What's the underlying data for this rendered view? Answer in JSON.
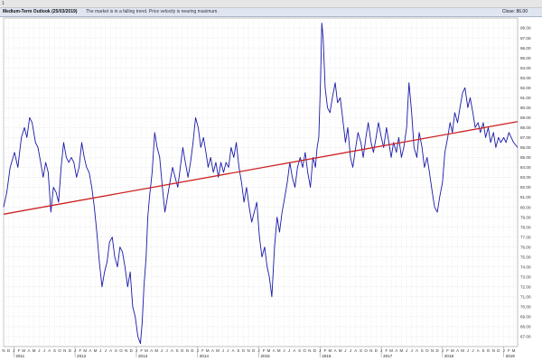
{
  "window": {
    "tag": "1",
    "title": "Medium-Term Outlook (25/03/2019)",
    "description": "The market is in a falling trend. Price velocity is nearing maximum.",
    "close_label": "Close:",
    "close_value": "86.00"
  },
  "chart_data": {
    "type": "line",
    "title": "Medium-Term Outlook (25/03/2019)",
    "x_axis": {
      "range": [
        "2010-11-01",
        "2019-03-25"
      ],
      "year_labels": [
        "2011",
        "2012",
        "2013",
        "2014",
        "2015",
        "2016",
        "2017",
        "2018",
        "2019"
      ],
      "month_labels": [
        "N",
        "D",
        "J",
        "F",
        "M",
        "A",
        "M",
        "J",
        "J",
        "A",
        "S",
        "O",
        "N",
        "D",
        "J",
        "F",
        "M",
        "A",
        "M",
        "J",
        "J",
        "A",
        "S",
        "O",
        "N",
        "D",
        "J",
        "F",
        "M",
        "A",
        "M",
        "J",
        "J",
        "A",
        "S",
        "O",
        "N",
        "D",
        "J",
        "F",
        "M",
        "A",
        "M",
        "J",
        "J",
        "A",
        "S",
        "O",
        "N",
        "D",
        "J",
        "F",
        "M",
        "A",
        "M",
        "J",
        "J",
        "A",
        "S",
        "O",
        "N",
        "D",
        "J",
        "F",
        "M",
        "A",
        "M",
        "J",
        "J",
        "A",
        "S",
        "O",
        "N",
        "D",
        "J",
        "F",
        "M",
        "A",
        "M",
        "J",
        "J",
        "A",
        "S",
        "O",
        "N",
        "D",
        "J",
        "F",
        "M",
        "A",
        "M",
        "J",
        "J",
        "A",
        "S",
        "O",
        "N",
        "D",
        "J",
        "F",
        "M"
      ]
    },
    "y_axis": {
      "position": "right",
      "range": [
        66,
        99
      ],
      "tick_labels": [
        "67.00",
        "68.00",
        "69.00",
        "70.00",
        "71.00",
        "72.00",
        "73.00",
        "74.00",
        "75.00",
        "76.00",
        "77.00",
        "78.00",
        "79.00",
        "80.00",
        "81.00",
        "82.00",
        "83.00",
        "84.00",
        "85.00",
        "86.00",
        "87.00",
        "88.00",
        "89.00",
        "90.00",
        "91.00",
        "92.00",
        "93.00",
        "94.00",
        "95.00",
        "96.00",
        "97.00",
        "98.00"
      ]
    },
    "grid": true,
    "series": [
      {
        "kind": "price",
        "color": "#1a1aaa",
        "points": [
          [
            "2010-11-01",
            80.0
          ],
          [
            "2010-11-20",
            81.5
          ],
          [
            "2010-12-10",
            84.0
          ],
          [
            "2011-01-05",
            85.5
          ],
          [
            "2011-01-25",
            84.0
          ],
          [
            "2011-02-15",
            87.0
          ],
          [
            "2011-03-05",
            88.0
          ],
          [
            "2011-03-20",
            87.0
          ],
          [
            "2011-04-05",
            89.0
          ],
          [
            "2011-04-20",
            88.5
          ],
          [
            "2011-05-10",
            86.5
          ],
          [
            "2011-05-25",
            86.0
          ],
          [
            "2011-06-10",
            84.5
          ],
          [
            "2011-06-25",
            83.0
          ],
          [
            "2011-07-10",
            84.5
          ],
          [
            "2011-07-25",
            83.5
          ],
          [
            "2011-08-10",
            79.5
          ],
          [
            "2011-08-25",
            82.0
          ],
          [
            "2011-09-10",
            81.5
          ],
          [
            "2011-09-25",
            80.5
          ],
          [
            "2011-10-10",
            84.0
          ],
          [
            "2011-10-25",
            86.5
          ],
          [
            "2011-11-10",
            85.0
          ],
          [
            "2011-11-25",
            84.5
          ],
          [
            "2011-12-10",
            85.0
          ],
          [
            "2011-12-25",
            84.5
          ],
          [
            "2012-01-10",
            83.0
          ],
          [
            "2012-01-25",
            84.0
          ],
          [
            "2012-02-10",
            86.5
          ],
          [
            "2012-02-25",
            85.0
          ],
          [
            "2012-03-10",
            84.0
          ],
          [
            "2012-03-25",
            83.5
          ],
          [
            "2012-04-10",
            82.0
          ],
          [
            "2012-04-25",
            80.0
          ],
          [
            "2012-05-10",
            77.5
          ],
          [
            "2012-05-25",
            74.5
          ],
          [
            "2012-06-10",
            72.0
          ],
          [
            "2012-06-25",
            73.5
          ],
          [
            "2012-07-10",
            74.5
          ],
          [
            "2012-07-25",
            76.5
          ],
          [
            "2012-08-10",
            77.0
          ],
          [
            "2012-08-25",
            75.0
          ],
          [
            "2012-09-10",
            74.0
          ],
          [
            "2012-09-25",
            76.0
          ],
          [
            "2012-10-10",
            75.5
          ],
          [
            "2012-10-25",
            74.0
          ],
          [
            "2012-11-10",
            72.0
          ],
          [
            "2012-11-25",
            73.5
          ],
          [
            "2012-12-10",
            70.0
          ],
          [
            "2012-12-25",
            69.0
          ],
          [
            "2013-01-10",
            67.0
          ],
          [
            "2013-01-25",
            66.3
          ],
          [
            "2013-02-05",
            68.5
          ],
          [
            "2013-02-15",
            72.0
          ],
          [
            "2013-02-28",
            75.0
          ],
          [
            "2013-03-10",
            79.0
          ],
          [
            "2013-03-20",
            81.0
          ],
          [
            "2013-04-05",
            83.5
          ],
          [
            "2013-04-20",
            87.5
          ],
          [
            "2013-05-05",
            86.0
          ],
          [
            "2013-05-20",
            85.0
          ],
          [
            "2013-06-05",
            82.0
          ],
          [
            "2013-06-20",
            79.5
          ],
          [
            "2013-07-05",
            81.0
          ],
          [
            "2013-07-20",
            82.5
          ],
          [
            "2013-08-05",
            84.0
          ],
          [
            "2013-08-20",
            83.0
          ],
          [
            "2013-09-05",
            82.0
          ],
          [
            "2013-09-20",
            84.0
          ],
          [
            "2013-10-05",
            86.0
          ],
          [
            "2013-10-20",
            84.5
          ],
          [
            "2013-11-05",
            83.0
          ],
          [
            "2013-11-20",
            84.5
          ],
          [
            "2013-12-05",
            86.5
          ],
          [
            "2013-12-20",
            89.0
          ],
          [
            "2014-01-05",
            88.0
          ],
          [
            "2014-01-20",
            86.0
          ],
          [
            "2014-02-05",
            87.0
          ],
          [
            "2014-02-20",
            85.5
          ],
          [
            "2014-03-05",
            84.0
          ],
          [
            "2014-03-20",
            85.0
          ],
          [
            "2014-04-05",
            83.5
          ],
          [
            "2014-04-20",
            84.5
          ],
          [
            "2014-05-05",
            83.0
          ],
          [
            "2014-05-20",
            84.5
          ],
          [
            "2014-06-05",
            83.5
          ],
          [
            "2014-06-20",
            84.5
          ],
          [
            "2014-07-05",
            84.0
          ],
          [
            "2014-07-20",
            86.0
          ],
          [
            "2014-08-05",
            85.0
          ],
          [
            "2014-08-20",
            86.5
          ],
          [
            "2014-09-05",
            84.0
          ],
          [
            "2014-09-20",
            82.5
          ],
          [
            "2014-10-05",
            80.5
          ],
          [
            "2014-10-20",
            82.0
          ],
          [
            "2014-11-05",
            80.0
          ],
          [
            "2014-11-20",
            78.5
          ],
          [
            "2014-12-05",
            79.5
          ],
          [
            "2014-12-20",
            80.5
          ],
          [
            "2015-01-05",
            77.0
          ],
          [
            "2015-01-20",
            75.0
          ],
          [
            "2015-02-05",
            76.0
          ],
          [
            "2015-02-20",
            74.0
          ],
          [
            "2015-03-05",
            73.0
          ],
          [
            "2015-03-20",
            71.0
          ],
          [
            "2015-04-05",
            76.0
          ],
          [
            "2015-04-20",
            79.0
          ],
          [
            "2015-05-05",
            77.5
          ],
          [
            "2015-05-20",
            79.5
          ],
          [
            "2015-06-05",
            81.0
          ],
          [
            "2015-06-20",
            82.5
          ],
          [
            "2015-07-05",
            84.5
          ],
          [
            "2015-07-20",
            83.0
          ],
          [
            "2015-08-05",
            82.0
          ],
          [
            "2015-08-20",
            84.0
          ],
          [
            "2015-09-05",
            85.0
          ],
          [
            "2015-09-20",
            84.0
          ],
          [
            "2015-10-05",
            85.5
          ],
          [
            "2015-10-20",
            83.5
          ],
          [
            "2015-11-05",
            82.0
          ],
          [
            "2015-11-20",
            85.0
          ],
          [
            "2015-12-05",
            84.0
          ],
          [
            "2015-12-15",
            86.0
          ],
          [
            "2015-12-25",
            87.0
          ],
          [
            "2016-01-05",
            93.0
          ],
          [
            "2016-01-12",
            98.5
          ],
          [
            "2016-01-20",
            97.0
          ],
          [
            "2016-02-01",
            92.0
          ],
          [
            "2016-02-15",
            90.0
          ],
          [
            "2016-03-01",
            89.5
          ],
          [
            "2016-03-15",
            91.0
          ],
          [
            "2016-04-01",
            92.5
          ],
          [
            "2016-04-15",
            90.5
          ],
          [
            "2016-05-01",
            91.0
          ],
          [
            "2016-05-15",
            89.0
          ],
          [
            "2016-06-01",
            86.5
          ],
          [
            "2016-06-15",
            88.0
          ],
          [
            "2016-07-01",
            85.0
          ],
          [
            "2016-07-15",
            84.0
          ],
          [
            "2016-08-01",
            86.0
          ],
          [
            "2016-08-15",
            87.5
          ],
          [
            "2016-09-01",
            86.5
          ],
          [
            "2016-09-15",
            85.0
          ],
          [
            "2016-10-01",
            87.0
          ],
          [
            "2016-10-15",
            88.5
          ],
          [
            "2016-11-01",
            86.5
          ],
          [
            "2016-11-15",
            85.5
          ],
          [
            "2016-12-01",
            87.0
          ],
          [
            "2016-12-15",
            88.5
          ],
          [
            "2017-01-01",
            87.0
          ],
          [
            "2017-01-15",
            86.0
          ],
          [
            "2017-02-01",
            88.0
          ],
          [
            "2017-02-15",
            86.5
          ],
          [
            "2017-03-01",
            85.0
          ],
          [
            "2017-03-15",
            86.5
          ],
          [
            "2017-04-01",
            85.5
          ],
          [
            "2017-04-15",
            87.0
          ],
          [
            "2017-05-01",
            85.0
          ],
          [
            "2017-05-15",
            86.0
          ],
          [
            "2017-06-01",
            88.0
          ],
          [
            "2017-06-15",
            92.5
          ],
          [
            "2017-07-01",
            89.5
          ],
          [
            "2017-07-15",
            86.0
          ],
          [
            "2017-08-01",
            85.0
          ],
          [
            "2017-08-15",
            87.5
          ],
          [
            "2017-09-01",
            86.0
          ],
          [
            "2017-09-15",
            84.0
          ],
          [
            "2017-10-01",
            85.0
          ],
          [
            "2017-10-15",
            83.5
          ],
          [
            "2017-11-01",
            81.5
          ],
          [
            "2017-11-15",
            80.0
          ],
          [
            "2017-12-01",
            79.5
          ],
          [
            "2017-12-15",
            81.0
          ],
          [
            "2018-01-01",
            82.5
          ],
          [
            "2018-01-15",
            85.5
          ],
          [
            "2018-02-01",
            87.0
          ],
          [
            "2018-02-15",
            88.5
          ],
          [
            "2018-03-01",
            87.5
          ],
          [
            "2018-03-15",
            89.5
          ],
          [
            "2018-04-01",
            88.5
          ],
          [
            "2018-04-15",
            90.0
          ],
          [
            "2018-05-01",
            91.5
          ],
          [
            "2018-05-15",
            92.0
          ],
          [
            "2018-06-01",
            90.0
          ],
          [
            "2018-06-15",
            91.0
          ],
          [
            "2018-07-01",
            89.5
          ],
          [
            "2018-07-15",
            88.0
          ],
          [
            "2018-08-01",
            88.5
          ],
          [
            "2018-08-15",
            87.5
          ],
          [
            "2018-09-01",
            88.5
          ],
          [
            "2018-09-15",
            87.0
          ],
          [
            "2018-10-01",
            88.0
          ],
          [
            "2018-10-15",
            86.5
          ],
          [
            "2018-11-01",
            87.5
          ],
          [
            "2018-11-15",
            86.0
          ],
          [
            "2018-12-01",
            87.0
          ],
          [
            "2018-12-15",
            86.5
          ],
          [
            "2019-01-01",
            87.0
          ],
          [
            "2019-01-15",
            86.5
          ],
          [
            "2019-02-01",
            87.5
          ],
          [
            "2019-02-15",
            87.0
          ],
          [
            "2019-03-01",
            86.5
          ],
          [
            "2019-03-25",
            86.0
          ]
        ]
      },
      {
        "kind": "trend",
        "color": "#cc2222",
        "points": [
          [
            "2010-11-01",
            79.3
          ],
          [
            "2019-03-25",
            88.6
          ]
        ]
      }
    ]
  }
}
